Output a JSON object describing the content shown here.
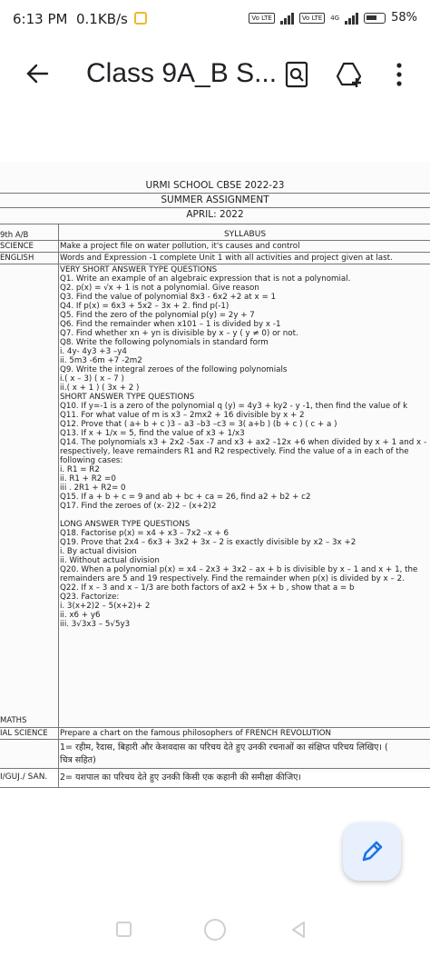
{
  "status": {
    "time": "6:13 PM",
    "speed": "0.1KB/s",
    "volte1": "Vo LTE",
    "volte2": "Vo LTE",
    "net": "4G",
    "battery": "58%"
  },
  "appbar": {
    "title": "Class 9A_B S...",
    "icons": [
      "back-arrow-icon",
      "search-in-document-icon",
      "add-to-drive-icon",
      "more-vert-icon"
    ]
  },
  "document": {
    "school": "URMI SCHOOL CBSE 2022-23",
    "assignment": "SUMMER ASSIGNMENT",
    "month": "APRIL: 2022",
    "class_label": "9th A/B",
    "syllabus_label": "SYLLABUS",
    "subjects": {
      "science": "SCIENCE",
      "english": "ENGLISH",
      "maths": "MATHS",
      "social": "IAL SCIENCE",
      "hindi": "I/GUJ./ SAN."
    },
    "science_task": "Make a project file on water pollution, it's causes and control",
    "english_task": "Words and Expression -1 complete Unit 1 with all activities and project given at last.",
    "maths_lines": [
      "VERY SHORT ANSWER TYPE QUESTIONS",
      "Q1. Write an example of an algebraic expression that is not a polynomial.",
      "Q2. p(x) = √x + 1 is not a polynomial. Give reason",
      "Q3. Find the value of polynomial 8x3 - 6x2 +2 at x = 1",
      "Q4. If p(x) = 6x3 + 5x2 – 3x + 2. find p(-1)",
      "Q5. Find the zero of the polynomial p(y) = 2y + 7",
      "Q6. Find the remainder when x101 – 1 is divided by x -1",
      "Q7. Find whether xn + yn is divisible by x – y ( y ≠ 0) or not.",
      "Q8. Write the following polynomials in standard form",
      "i. 4y- 4y3 +3 –y4",
      "ii. 5m3 -6m +7 -2m2",
      "Q9. Write the integral zeroes of the following polynomials",
      "i.( x – 3) ( x – 7 )",
      "ii.( x + 1 ) ( 3x + 2 )",
      "SHORT ANSWER TYPE QUESTIONS",
      "Q10. If y=-1 is a zero of the polynomial q (y) = 4y3 + ky2 - y -1, then find the value of k",
      " Q11. For what value of m is x3 – 2mx2 + 16 divisible by x + 2",
      "Q12. Prove that ( a+ b + c )3 – a3 –b3 –c3 = 3( a+b ) (b + c ) ( c + a )",
      "Q13. If x + 1/x = 5, find the value of x3 + 1/x3",
      "Q14. The polynomials x3 + 2x2 -5ax -7 and x3 + ax2 –12x +6 when divided by x + 1 and x – 2",
      "respectively, leave remainders R1 and R2 respectively. Find the value of a in each of the",
      "following cases:",
      "i. R1 = R2",
      "ii. R1 + R2 =0",
      "iii . 2R1 + R2= 0",
      "Q15. If a + b + c = 9 and ab + bc + ca = 26, find a2 + b2 + c2",
      "Q17. Find the zeroes of (x- 2)2 – (x+2)2",
      "",
      "LONG ANSWER TYPE QUESTIONS",
      "Q18. Factorise p(x) = x4 + x3 – 7x2 –x + 6",
      "Q19. Prove that 2x4 – 6x3 + 3x2 + 3x – 2 is exactly divisible by x2 – 3x +2",
      "i. By actual division",
      "ii. Without actual division",
      "Q20. When a polynomial p(x) = x4 – 2x3 + 3x2 – ax + b is divisible by x – 1 and x + 1, the",
      "remainders are 5 and 19 respectively. Find the remainder when p(x) is divided by x – 2.",
      "Q22. If x – 3 and x – 1/3 are both factors of ax2 + 5x + b , show that a = b",
      "Q23. Factorize:",
      "i. 3(x+2)2 – 5(x+2)+ 2",
      "ii. x6 + y6",
      "iii. 3√3x3 – 5√5y3"
    ],
    "social_task": "Prepare a chart on the famous philosophers of FRENCH REVOLUTION",
    "hindi_line1": "1= रहीम, रैदास, बिहारी और केशवदास का परिचय देते हुए उनकी रचनाओं का संक्षिप्त परिचय लिखिए। (",
    "hindi_line2": "चित्र सहित)",
    "hindi_line3": "2= यशपाल का परिचय देते हुए उनकी किसी एक कहानी की समीक्षा कीजिए।"
  },
  "fab_icon": "edit-pencil-icon",
  "nav_icons": [
    "recents-square-icon",
    "home-circle-icon",
    "back-triangle-icon"
  ],
  "colors": {
    "accent": "#1a73e8",
    "fab_bg": "#e8f0fe",
    "noti": "#f2b72a"
  }
}
